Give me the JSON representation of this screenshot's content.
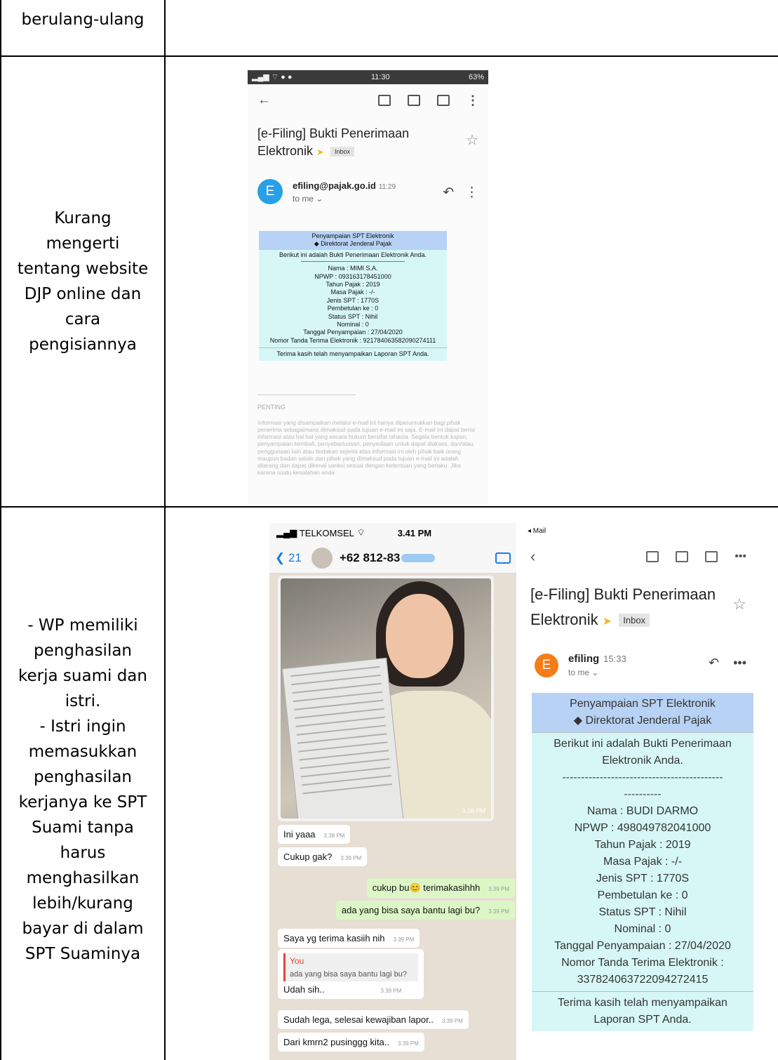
{
  "rows": [
    {
      "left_lines": [
        "berulang-ulang"
      ]
    },
    {
      "left_lines": [
        "Kurang",
        "mengerti",
        "tentang website",
        "DJP online dan",
        "cara",
        "pengisiannya"
      ]
    },
    {
      "left_lines": [
        "- WP memiliki",
        "penghasilan",
        "kerja suami dan",
        "istri.",
        "- Istri ingin",
        "memasukkan",
        "penghasilan",
        "kerjanya ke SPT",
        "Suami tanpa",
        "harus",
        "menghasilkan",
        "lebih/kurang",
        "bayar di dalam",
        "SPT Suaminya"
      ]
    }
  ],
  "email1": {
    "status_time": "11:30",
    "status_right": "63%",
    "subject_line1": "[e-Filing] Bukti Penerimaan",
    "subject_line2": "Elektronik",
    "inbox": "Inbox",
    "avatar": "E",
    "from": "efiling@pajak.go.id",
    "time": "11:29",
    "to": "to me ⌄",
    "receipt_head1": "Penyampaian SPT Elektronik",
    "receipt_head2": "◆ Direktorat Jenderal Pajak",
    "receipt_intro": "Berikut ini adalah Bukti Penerimaan Elektronik Anda.",
    "fields": [
      "Nama : MIMI S.A.",
      "NPWP : 093163178451000",
      "Tahun Pajak : 2019",
      "Masa Pajak : -/-",
      "Jenis SPT : 1770S",
      "Pembetulan ke : 0",
      "Status SPT : Nihil",
      "Nominal : 0",
      "Tanggal Penyampaian : 27/04/2020",
      "Nomor Tanda Terima Elektronik : 921784063582090274111"
    ],
    "receipt_footer": "Terima kasih telah menyampaikan Laporan SPT Anda.",
    "penting": "PENTING",
    "fine_print": "Informasi yang disampaikan melalui e-mail ini hanya diperuntukkan bagi pihak penerima sebagaimana dimaksud pada tujuan e-mail ini saja. E-mail ini dapat berisi informasi atau hal hal yang secara hukum bersifat rahasia. Segala bentuk kajian, penyampaian kembali, penyebarluasan, penyediaan untuk dapat diakses, dan/atau penggunaan lain atau tindakan sejenis atas informasi ini oleh pihak baik orang maupun badan selain dari pihak yang dimaksud pada tujuan e-mail ini adalah dilarang dan dapat dikenai sanksi sesuai dengan ketentuan yang berlaku. Jika karena suatu kesalahan anda"
  },
  "whatsapp": {
    "carrier": "TELKOMSEL",
    "time": "3.41 PM",
    "back": "21",
    "contact": "+62 812-83",
    "photo_time": "3.38 PM",
    "messages": [
      {
        "text": "Ini yaaa",
        "time": "3.38 PM",
        "dir": "in"
      },
      {
        "text": "Cukup gak?",
        "time": "3.39 PM",
        "dir": "in"
      },
      {
        "text": "cukup bu😊 terimakasihhh",
        "time": "3.39 PM",
        "dir": "out"
      },
      {
        "text": "ada yang bisa saya bantu lagi bu?",
        "time": "3.39 PM",
        "dir": "out"
      },
      {
        "text": "Saya yg terima kasiih nih",
        "time": "3.39 PM",
        "dir": "in"
      },
      {
        "text": "Udah sih..",
        "time": "3.39 PM",
        "dir": "in"
      },
      {
        "text": "Sudah lega, selesai kewajiban lapor..",
        "time": "3.39 PM",
        "dir": "in"
      },
      {
        "text": "Dari kmrn2 pusinggg kita..",
        "time": "3.39 PM",
        "dir": "in"
      }
    ],
    "quote_who": "You",
    "quote_text": "ada yang bisa saya bantu lagi bu?"
  },
  "email2": {
    "back_label": "◂ Mail",
    "subject_line1": "[e-Filing] Bukti Penerimaan",
    "subject_line2": "Elektronik",
    "inbox": "Inbox",
    "avatar": "E",
    "from": "efiling",
    "time": "15:33",
    "to": "to me ⌄",
    "receipt_head1": "Penyampaian SPT Elektronik",
    "receipt_head2": "◆ Direktorat Jenderal Pajak",
    "receipt_intro1": "Berikut ini adalah Bukti Penerimaan",
    "receipt_intro2": "Elektronik Anda.",
    "dash1": "-------------------------------------------",
    "dash2": "----------",
    "fields": [
      "Nama : BUDI DARMO",
      "NPWP : 498049782041000",
      "Tahun Pajak : 2019",
      "Masa Pajak : -/-",
      "Jenis SPT : 1770S",
      "Pembetulan ke : 0",
      "Status SPT : Nihil",
      "Nominal : 0",
      "Tanggal Penyampaian : 27/04/2020",
      "Nomor Tanda Terima Elektronik :",
      "337824063722094272415"
    ],
    "footer1": "Terima kasih telah menyampaikan",
    "footer2": "Laporan SPT Anda."
  }
}
